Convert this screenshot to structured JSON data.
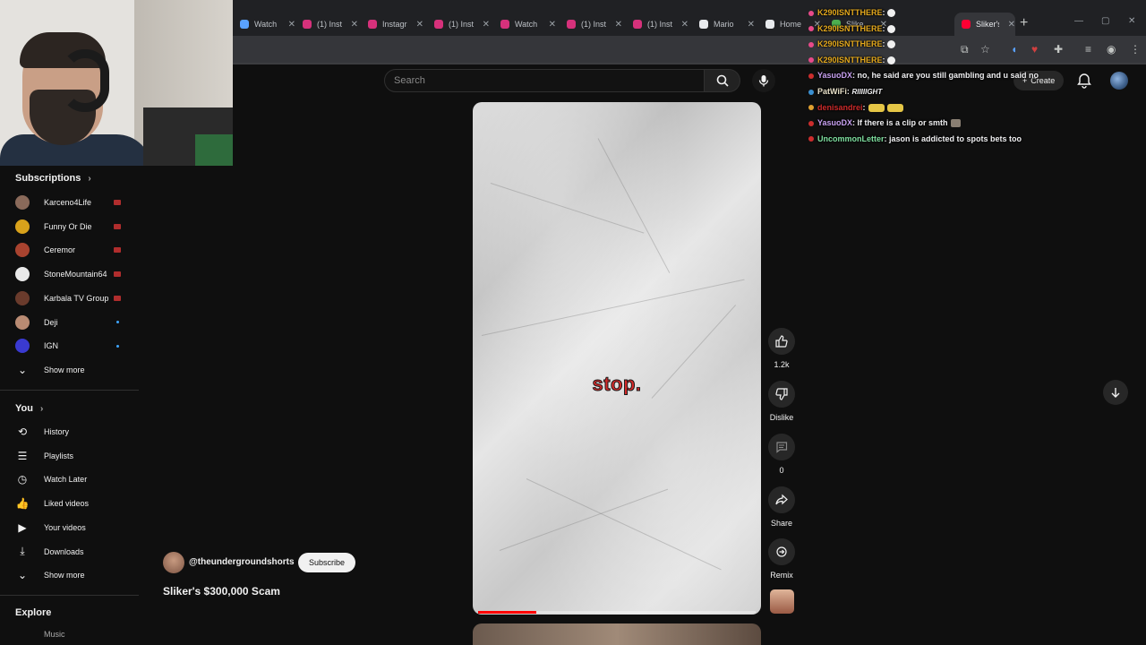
{
  "browser": {
    "tabs": [
      {
        "title": "Watch",
        "color": "#5aa2ff"
      },
      {
        "title": "(1) Inst",
        "color": "#d6317b"
      },
      {
        "title": "Instagra",
        "color": "#d6317b"
      },
      {
        "title": "(1) Inst",
        "color": "#d6317b"
      },
      {
        "title": "Watch",
        "color": "#d6317b"
      },
      {
        "title": "(1) Inst",
        "color": "#d6317b"
      },
      {
        "title": "(1) Inst",
        "color": "#d6317b"
      },
      {
        "title": "Mario",
        "color": "#e8eaed"
      },
      {
        "title": "Home",
        "color": "#e8eaed"
      },
      {
        "title": "Slike",
        "color": "#4caf50"
      },
      {
        "title": "Sliker's",
        "color": "#ff0033"
      }
    ]
  },
  "search": {
    "placeholder": "Search"
  },
  "header": {
    "create_label": "Create"
  },
  "sidebar": {
    "subscriptions_title": "Subscriptions",
    "subscriptions": [
      {
        "name": "Karceno4Life",
        "avatar": "#8a6a5a",
        "status": "live"
      },
      {
        "name": "Funny Or Die",
        "avatar": "#d9a21b",
        "status": "live"
      },
      {
        "name": "Ceremor",
        "avatar": "#a9432f",
        "status": "live"
      },
      {
        "name": "StoneMountain64",
        "avatar": "#e9e9e9",
        "status": "live"
      },
      {
        "name": "Karbala TV Group",
        "avatar": "#6a3b2c",
        "status": "live"
      },
      {
        "name": "Deji",
        "avatar": "#b98b73",
        "status": "new"
      },
      {
        "name": "IGN",
        "avatar": "#3a3ad1",
        "status": "new"
      }
    ],
    "subs_show_more": "Show more",
    "you_title": "You",
    "you_items": [
      {
        "label": "History",
        "icon": "history-icon",
        "glyph": "⟲"
      },
      {
        "label": "Playlists",
        "icon": "playlists-icon",
        "glyph": "☰"
      },
      {
        "label": "Watch Later",
        "icon": "watch-later-icon",
        "glyph": "◷"
      },
      {
        "label": "Liked videos",
        "icon": "like-icon",
        "glyph": "👍"
      },
      {
        "label": "Your videos",
        "icon": "your-videos-icon",
        "glyph": "▶"
      },
      {
        "label": "Downloads",
        "icon": "download-icon",
        "glyph": "⤓"
      }
    ],
    "you_show_more": "Show more",
    "explore_title": "Explore",
    "explore_first": "Music"
  },
  "video": {
    "overlay_text": "stop.",
    "progress_fraction": 0.21,
    "channel": "@theundergroundshorts",
    "subscribe_label": "Subscribe",
    "title": "Sliker's $300,000 Scam"
  },
  "actions": {
    "like_count": "1.2k",
    "dislike_label": "Dislike",
    "comment_count": "0",
    "share_label": "Share",
    "remix_label": "Remix"
  },
  "chat": [
    {
      "user": "K290ISNTTHERE",
      "color": "#e3a81d",
      "badge": "#e84a8a",
      "text": ":",
      "emote": true
    },
    {
      "user": "K290ISNTTHERE",
      "color": "#e3a81d",
      "badge": "#e84a8a",
      "text": ":",
      "emote": true
    },
    {
      "user": "K290ISNTTHERE",
      "color": "#e3a81d",
      "badge": "#e84a8a",
      "text": ":",
      "emote": true
    },
    {
      "user": "K290ISNTTHERE",
      "color": "#e3a81d",
      "badge": "#e84a8a",
      "text": ":",
      "emote": true
    },
    {
      "user": "YasuoDX",
      "color": "#c7a0f0",
      "badge": "#cc2d2d",
      "text": ": no, he said are you still gambling and u said no"
    },
    {
      "user": "PatWiFi",
      "color": "#e8e0c8",
      "badge": "#3a8fd0",
      "text": ":",
      "extra": "RIIIIIGHT"
    },
    {
      "user": "denisandrei",
      "color": "#cc2a2a",
      "badge": "#e0a030",
      "text": ":",
      "wide_emotes": 2
    },
    {
      "user": "YasuoDX",
      "color": "#c7a0f0",
      "badge": "#cc2d2d",
      "text": ": If there is a clip or smth",
      "square_emote": true
    },
    {
      "user": "UncommonLetter",
      "color": "#7fe0a0",
      "badge": "#cc2d2d",
      "text": ": jason is addicted to spots bets too"
    }
  ]
}
